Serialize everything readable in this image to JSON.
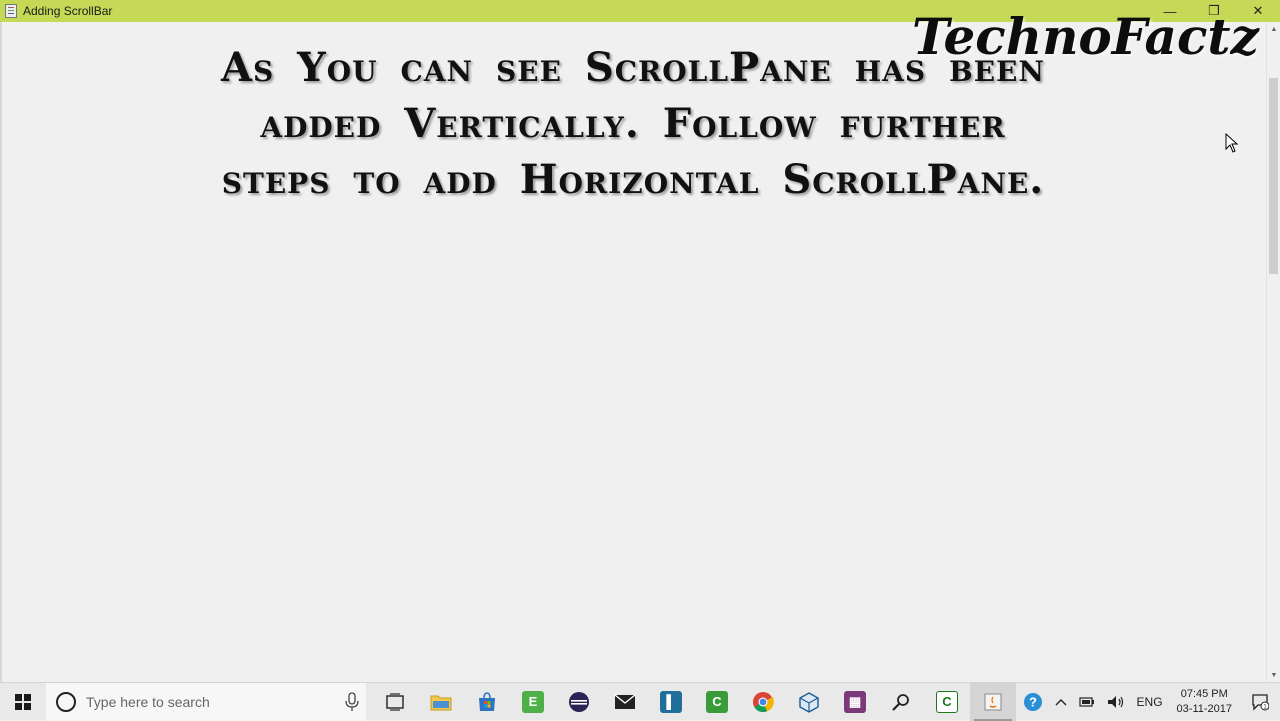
{
  "window": {
    "title": "Adding ScrollBar",
    "controls": {
      "minimize": "—",
      "restore": "❐",
      "close": "✕"
    }
  },
  "overlay": {
    "lines": [
      "As You can see ScrollPane has been",
      "added Vertically. Follow further",
      "steps to add Horizontal ScrollPane."
    ],
    "watermark": "TechnoFactz"
  },
  "scrollbar": {
    "up": "▲",
    "down": "▼"
  },
  "taskbar": {
    "search_placeholder": "Type here to search",
    "apps": [
      {
        "icon": "task-view-icon"
      },
      {
        "icon": "file-explorer-icon"
      },
      {
        "icon": "store-icon"
      },
      {
        "icon": "evernote-icon"
      },
      {
        "icon": "eclipse-icon"
      },
      {
        "icon": "mail-icon"
      },
      {
        "icon": "editor-icon"
      },
      {
        "icon": "camtasia-icon"
      },
      {
        "icon": "chrome-icon"
      },
      {
        "icon": "virtualbox-icon"
      },
      {
        "icon": "winrar-icon"
      },
      {
        "icon": "magnifier-icon"
      },
      {
        "icon": "camtasia-recorder-icon"
      },
      {
        "icon": "java-icon"
      }
    ],
    "tray": {
      "language": "ENG",
      "time": "07:45 PM",
      "date": "03-11-2017"
    }
  },
  "colors": {
    "titlebar": "#c6d957",
    "taskbar": "#e9e9e9",
    "background": "#f0f0f0"
  }
}
